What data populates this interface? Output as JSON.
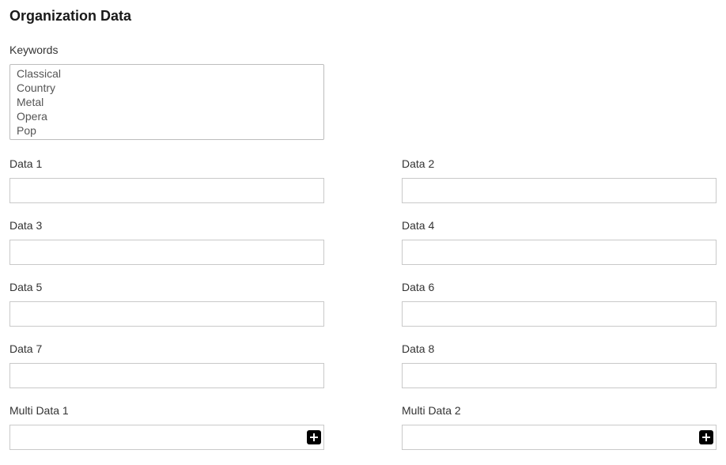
{
  "page_title": "Organization Data",
  "keywords": {
    "label": "Keywords",
    "options": [
      "Classical",
      "Country",
      "Metal",
      "Opera",
      "Pop"
    ]
  },
  "fields": {
    "data1": {
      "label": "Data 1",
      "value": ""
    },
    "data2": {
      "label": "Data 2",
      "value": ""
    },
    "data3": {
      "label": "Data 3",
      "value": ""
    },
    "data4": {
      "label": "Data 4",
      "value": ""
    },
    "data5": {
      "label": "Data 5",
      "value": ""
    },
    "data6": {
      "label": "Data 6",
      "value": ""
    },
    "data7": {
      "label": "Data 7",
      "value": ""
    },
    "data8": {
      "label": "Data 8",
      "value": ""
    }
  },
  "multi_fields": {
    "multi1": {
      "label": "Multi Data 1",
      "value": ""
    },
    "multi2": {
      "label": "Multi Data 2",
      "value": ""
    }
  }
}
